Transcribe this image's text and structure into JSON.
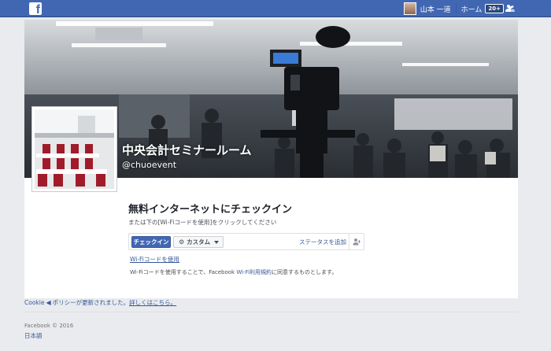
{
  "topbar": {
    "user_name": "山本 一道",
    "home_label": "ホーム",
    "notification_badge": "20+"
  },
  "page": {
    "name": "中央会計セミナールーム",
    "handle": "@chuoevent"
  },
  "checkin": {
    "title": "無料インターネットにチェックイン",
    "subtitle": "または下の[Wi-Fiコードを使用]をクリックしてください",
    "checkin_button": "チェックイン",
    "custom_button": "カスタム",
    "add_status": "ステータスを追加",
    "wifi_code_link": "Wi-Fiコードを使用",
    "terms_prefix": "Wi-Fiコードを使用することで、Facebook ",
    "terms_link": "Wi-Fi利用規約",
    "terms_suffix": "に同意するものとします。"
  },
  "cookie": {
    "prefix": "Cookie",
    "policy": "ポリシーが更新されました。",
    "details": "詳しくはこちら。"
  },
  "footer": {
    "copyright": "Facebook © 2016",
    "language": "日本語"
  },
  "colors": {
    "brand": "#4267b2",
    "link": "#365899",
    "background": "#e9ebee"
  }
}
